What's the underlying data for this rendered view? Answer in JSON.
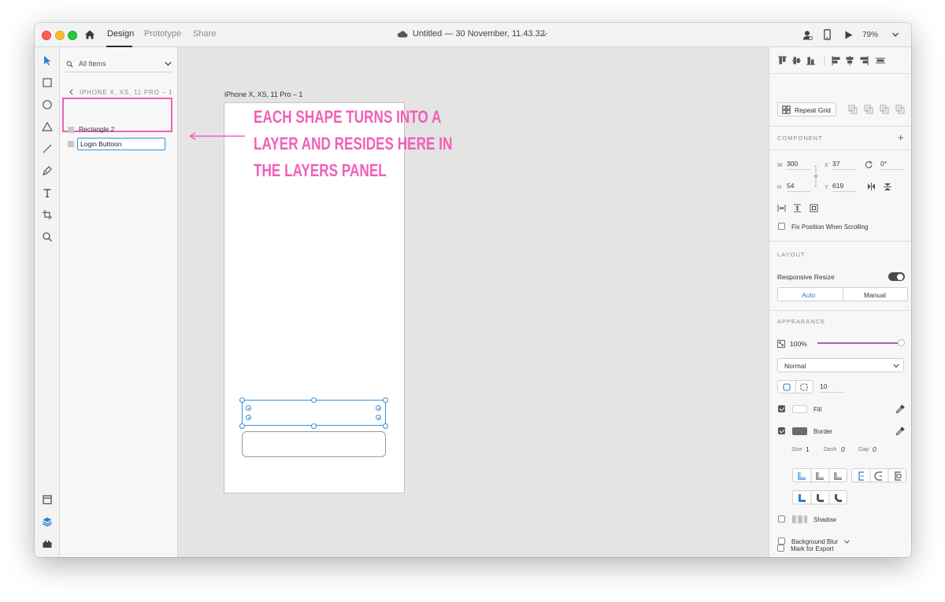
{
  "titlebar": {
    "tabs": [
      "Design",
      "Prototype",
      "Share"
    ],
    "document_title": "Untitled — 30 November, 11.43.32",
    "zoom": "79%"
  },
  "layers": {
    "filter_label": "All Items",
    "artboard_breadcrumb": "IPHONE X, XS, 11 PRO – 1",
    "items": [
      {
        "name": "Rectangle 2"
      },
      {
        "name": "Login Buttoon"
      }
    ]
  },
  "canvas": {
    "artboard_name": "iPhone X, XS, 11 Pro – 1",
    "annotation": [
      "EACH SHAPE TURNS INTO A",
      "LAYER AND RESIDES HERE IN",
      "THE LAYERS PANEL"
    ],
    "annotation_color": "#f25fb9",
    "selection_color": "#3b8fd9"
  },
  "inspector": {
    "repeat_grid": "Repeat Grid",
    "component_title": "COMPONENT",
    "w_label": "W",
    "w": "300",
    "h_label": "H",
    "h": "54",
    "x_label": "X",
    "x": "37",
    "y_label": "Y",
    "y": "619",
    "rotation": "0°",
    "fix_position": "Fix Position When Scrolling",
    "layout_title": "LAYOUT",
    "responsive_resize": "Responsive Resize",
    "auto": "Auto",
    "manual": "Manual",
    "appearance_title": "APPEARANCE",
    "opacity": "100%",
    "opacity_level": 1.0,
    "blend_mode": "Normal",
    "corner_radius": "10",
    "fill": "Fill",
    "fill_color": "#ffffff",
    "border": "Border",
    "border_color": "#6b6b6b",
    "size_label": "Size",
    "size": "1",
    "dash_label": "Dash",
    "dash": "0",
    "gap_label": "Gap",
    "gap": "0",
    "shadow": "Shadow",
    "background_blur": "Background Blur",
    "mark_export": "Mark for Export"
  }
}
